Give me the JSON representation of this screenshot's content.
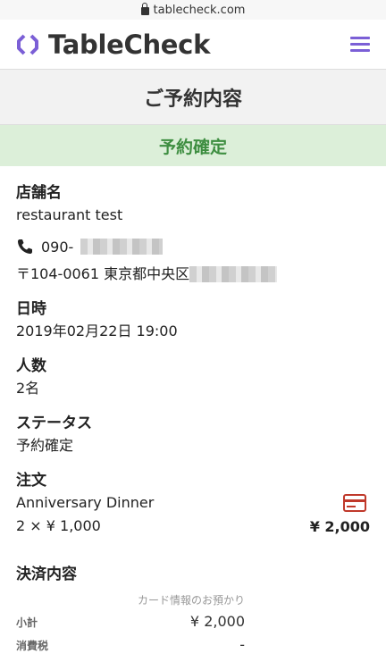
{
  "browser": {
    "url": "tablecheck.com"
  },
  "header": {
    "brand": "TableCheck",
    "menu_icon": "hamburger-icon",
    "accent": "#7b5fd6"
  },
  "page": {
    "title": "ご予約内容"
  },
  "status_banner": {
    "text": "予約確定",
    "color": "#3e8e41",
    "background": "#dcefd9"
  },
  "store": {
    "label": "店舗名",
    "name": "restaurant test",
    "phone_visible": "090-",
    "address_visible": "〒104-0061 東京都中央区"
  },
  "datetime": {
    "label": "日時",
    "value": "2019年02月22日 19:00"
  },
  "people": {
    "label": "人数",
    "value": "2名"
  },
  "status": {
    "label": "ステータス",
    "value": "予約確定"
  },
  "order": {
    "label": "注文",
    "item_name": "Anniversary Dinner",
    "quantity_price": "2 × ¥ 1,000",
    "total": "¥ 2,000",
    "card_icon_color": "#c0392b"
  },
  "payment": {
    "heading": "決済内容",
    "caption": "カード情報のお預かり",
    "rows": [
      {
        "key": "小計",
        "value": "¥ 2,000"
      },
      {
        "key": "消費税",
        "value": "-"
      }
    ]
  }
}
